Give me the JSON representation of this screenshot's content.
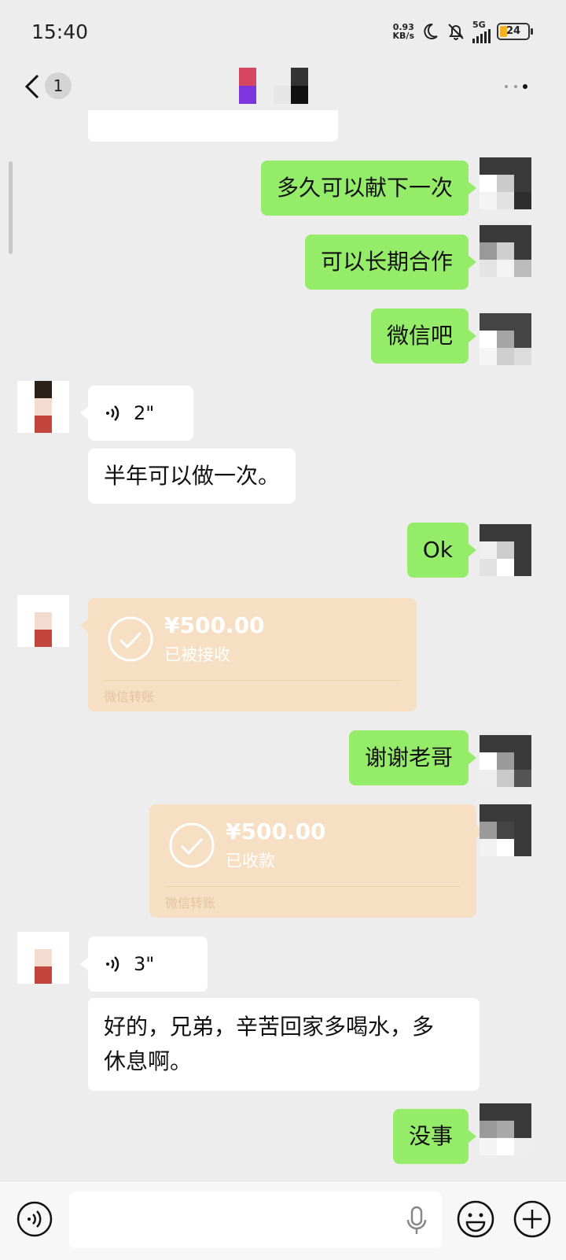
{
  "status_bar": {
    "time": "15:40",
    "net_speed_value": "0.93",
    "net_speed_unit": "KB/s",
    "network": "5G",
    "battery": "24"
  },
  "header": {
    "unread_count": "1"
  },
  "messages": {
    "m1": "多久可以献下一次",
    "m2": "可以长期合作",
    "m3": "微信吧",
    "m4_voice": "2\"",
    "m5": "半年可以做一次。",
    "m6": "Ok",
    "m7_transfer": {
      "amount": "¥500.00",
      "status": "已被接收",
      "brand": "微信转账"
    },
    "m8": "谢谢老哥",
    "m9_transfer": {
      "amount": "¥500.00",
      "status": "已收款",
      "brand": "微信转账"
    },
    "m10_voice": "3\"",
    "m11_line1": "好的，兄弟，辛苦回家多喝水，多",
    "m11_line2": "休息啊。",
    "m12": "没事"
  },
  "colors": {
    "background": "#ededed",
    "outgoing_bubble": "#95ec69",
    "incoming_bubble": "#ffffff",
    "transfer_card": "#f6dfc2"
  }
}
